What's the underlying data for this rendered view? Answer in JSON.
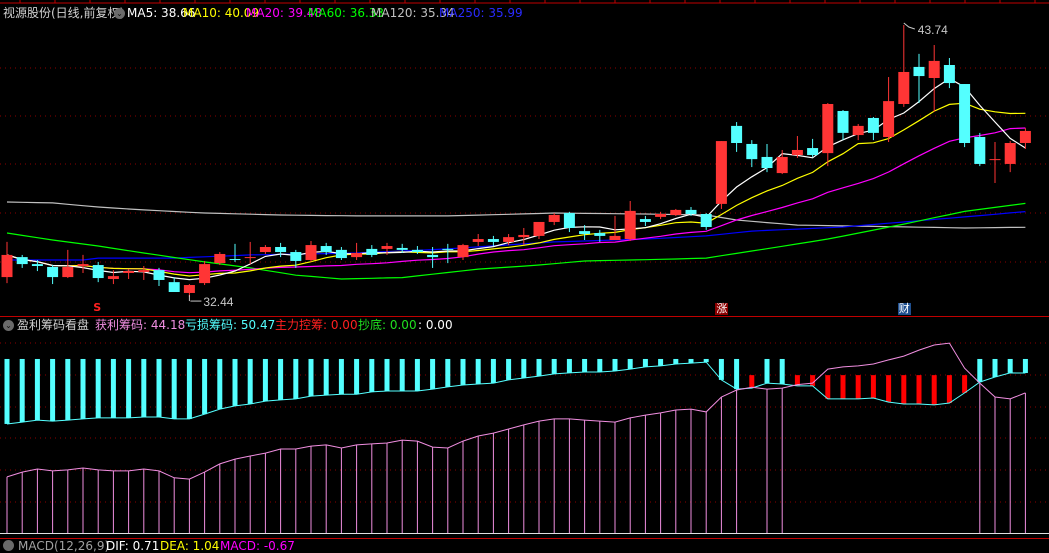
{
  "header": {
    "title": "视源股份(日线,前复权)",
    "ma5": "MA5: 38.66",
    "ma10": "MA10: 40.09",
    "ma20": "MA20: 39.48",
    "ma60": "MA60: 36.33",
    "ma120": "MA120: 35.34",
    "ma250": "MA250: 35.99"
  },
  "indicator_header": {
    "name": "盈利筹码看盘",
    "profit": "获利筹码: 44.18",
    "loss": "亏损筹码: 50.47",
    "main_control": "主力控筹: 0.00",
    "bottom_fish": "抄底: 0.00",
    "extra": ": 0.00"
  },
  "macd_header": {
    "name": "MACD(12,26,9)",
    "dif": "DIF: 0.71",
    "dea": "DEA: 1.04",
    "macd": "MACD: -0.67"
  },
  "colors": {
    "up": "#ff3535",
    "down": "#54ffff",
    "ma5": "#ffffff",
    "ma10": "#ffff00",
    "ma20": "#ff00ff",
    "ma60": "#00ff00",
    "ma120": "#c0c0c0",
    "ma250": "#0000ff",
    "profit": "#f08ee0",
    "red_bar": "#ff0000",
    "grid": "#8b0000"
  },
  "chart_data": [
    {
      "type": "candlestick",
      "title": "视源股份(日线,前复权)",
      "ohlc": [
        [
          33.27,
          34.73,
          33.02,
          34.19
        ],
        [
          34.1,
          34.19,
          33.65,
          33.81
        ],
        [
          33.81,
          33.98,
          33.52,
          33.73
        ],
        [
          33.69,
          33.77,
          32.98,
          33.27
        ],
        [
          33.27,
          34.4,
          33.23,
          33.69
        ],
        [
          33.73,
          34.19,
          33.44,
          33.81
        ],
        [
          33.77,
          33.9,
          33.06,
          33.23
        ],
        [
          33.19,
          33.56,
          32.98,
          33.31
        ],
        [
          33.44,
          33.6,
          33.19,
          33.52
        ],
        [
          33.48,
          33.73,
          33.15,
          33.56
        ],
        [
          33.56,
          33.65,
          32.9,
          33.15
        ],
        [
          33.06,
          33.27,
          32.65,
          32.65
        ],
        [
          32.61,
          32.98,
          32.44,
          32.94
        ],
        [
          33.02,
          33.94,
          32.94,
          33.81
        ],
        [
          33.85,
          34.31,
          33.77,
          34.23
        ],
        [
          34.02,
          34.65,
          33.9,
          33.98
        ],
        [
          34.06,
          34.73,
          33.81,
          34.1
        ],
        [
          34.31,
          34.6,
          34.23,
          34.52
        ],
        [
          34.52,
          34.69,
          34.1,
          34.31
        ],
        [
          34.31,
          34.4,
          33.65,
          33.94
        ],
        [
          33.98,
          34.77,
          33.9,
          34.6
        ],
        [
          34.56,
          34.69,
          34.19,
          34.31
        ],
        [
          34.4,
          34.52,
          33.98,
          34.06
        ],
        [
          34.1,
          34.69,
          33.98,
          34.27
        ],
        [
          34.44,
          34.6,
          34.1,
          34.19
        ],
        [
          34.44,
          34.69,
          34.19,
          34.56
        ],
        [
          34.48,
          34.65,
          34.27,
          34.4
        ],
        [
          34.4,
          34.56,
          34.23,
          34.31
        ],
        [
          34.19,
          34.52,
          33.65,
          34.1
        ],
        [
          34.44,
          34.65,
          33.85,
          34.4
        ],
        [
          34.1,
          34.65,
          33.98,
          34.6
        ],
        [
          34.73,
          35.06,
          34.56,
          34.85
        ],
        [
          34.85,
          34.98,
          34.56,
          34.73
        ],
        [
          34.73,
          35.06,
          34.6,
          34.93
        ],
        [
          34.93,
          35.31,
          34.6,
          35.02
        ],
        [
          34.98,
          35.56,
          34.85,
          35.56
        ],
        [
          35.56,
          35.93,
          35.43,
          35.85
        ],
        [
          35.93,
          35.98,
          35.14,
          35.31
        ],
        [
          35.18,
          35.43,
          34.81,
          35.06
        ],
        [
          35.1,
          35.23,
          34.73,
          34.98
        ],
        [
          34.81,
          35.81,
          34.81,
          34.98
        ],
        [
          34.85,
          36.43,
          34.77,
          36.02
        ],
        [
          35.68,
          35.81,
          35.39,
          35.56
        ],
        [
          35.77,
          35.98,
          35.68,
          35.89
        ],
        [
          35.85,
          36.1,
          35.81,
          36.06
        ],
        [
          36.06,
          36.18,
          35.81,
          35.89
        ],
        [
          35.89,
          35.93,
          35.23,
          35.35
        ],
        [
          36.31,
          38.92,
          36.1,
          38.92
        ],
        [
          39.55,
          39.71,
          38.47,
          38.84
        ],
        [
          38.8,
          38.96,
          37.84,
          38.17
        ],
        [
          38.26,
          38.8,
          37.63,
          37.8
        ],
        [
          37.59,
          38.55,
          37.55,
          38.26
        ],
        [
          38.34,
          39.13,
          38.22,
          38.55
        ],
        [
          38.63,
          39.01,
          38.26,
          38.34
        ],
        [
          38.42,
          40.5,
          37.88,
          40.46
        ],
        [
          40.17,
          40.21,
          38.96,
          39.26
        ],
        [
          39.17,
          39.63,
          38.96,
          39.55
        ],
        [
          39.88,
          39.92,
          38.96,
          39.26
        ],
        [
          39.09,
          41.58,
          38.88,
          40.58
        ],
        [
          40.46,
          43.74,
          40.34,
          41.79
        ],
        [
          42.0,
          42.54,
          40.5,
          41.62
        ],
        [
          41.54,
          42.91,
          40.13,
          42.25
        ],
        [
          42.08,
          42.37,
          41.12,
          41.33
        ],
        [
          41.29,
          41.29,
          38.67,
          38.84
        ],
        [
          39.09,
          39.26,
          37.88,
          37.97
        ],
        [
          38.13,
          38.88,
          37.18,
          38.17
        ],
        [
          37.97,
          38.92,
          37.63,
          38.84
        ],
        [
          38.84,
          39.46,
          38.59,
          39.34
        ]
      ],
      "moving_averages": {
        "ma5": {
          "period": 5
        },
        "ma10": {
          "period": 10
        },
        "ma20": {
          "period": 20
        },
        "ma60_anchors": [
          [
            0,
            35.1
          ],
          [
            3,
            34.81
          ],
          [
            6,
            34.56
          ],
          [
            9,
            34.27
          ],
          [
            13,
            33.9
          ],
          [
            16,
            33.65
          ],
          [
            19,
            33.35
          ],
          [
            22,
            33.19
          ],
          [
            26,
            33.25
          ],
          [
            31,
            33.6
          ],
          [
            35,
            33.77
          ],
          [
            38,
            33.94
          ],
          [
            44,
            34.02
          ],
          [
            46,
            34.06
          ],
          [
            50,
            34.45
          ],
          [
            54,
            34.85
          ],
          [
            59,
            35.47
          ],
          [
            63,
            36.0
          ],
          [
            67,
            36.33
          ]
        ],
        "ma120_anchors": [
          [
            0,
            36.39
          ],
          [
            3,
            36.35
          ],
          [
            6,
            36.18
          ],
          [
            9,
            36.06
          ],
          [
            13,
            35.93
          ],
          [
            18,
            35.85
          ],
          [
            23,
            35.81
          ],
          [
            29,
            35.81
          ],
          [
            36,
            35.93
          ],
          [
            42,
            35.89
          ],
          [
            46,
            35.85
          ],
          [
            48,
            35.64
          ],
          [
            52,
            35.43
          ],
          [
            63,
            35.31
          ],
          [
            67,
            35.34
          ]
        ],
        "ma250_anchors": [
          [
            0,
            33.98
          ],
          [
            5,
            33.98
          ],
          [
            6,
            34.06
          ],
          [
            11,
            34.06
          ],
          [
            16,
            34.19
          ],
          [
            23,
            34.27
          ],
          [
            29,
            34.44
          ],
          [
            36,
            34.73
          ],
          [
            42,
            34.85
          ],
          [
            46,
            34.98
          ],
          [
            49,
            35.18
          ],
          [
            55,
            35.35
          ],
          [
            59,
            35.56
          ],
          [
            63,
            35.77
          ],
          [
            67,
            35.99
          ]
        ]
      },
      "annotations": {
        "high": {
          "index": 59,
          "label": "43.74"
        },
        "low": {
          "index": 12,
          "label": "32.44"
        },
        "markers": [
          {
            "index": 6,
            "label": "S",
            "color": "#ff2020"
          },
          {
            "index": 47,
            "label": "涨",
            "color": "#8b0000"
          },
          {
            "index": 59,
            "label": "财",
            "color": "#1f4f8f"
          }
        ]
      },
      "ylim": [
        32.2,
        44.0
      ]
    },
    {
      "type": "bar",
      "title": "盈利筹码看盘",
      "profit": [
        17.7,
        19.2,
        20.2,
        19.6,
        19.9,
        20.5,
        19.9,
        19.6,
        19.6,
        20.2,
        19.6,
        17.4,
        17.0,
        19.2,
        21.8,
        23.3,
        24.3,
        25.2,
        26.5,
        26.5,
        27.4,
        27.8,
        26.8,
        27.8,
        28.1,
        28.4,
        29.3,
        29.0,
        27.1,
        26.8,
        29.0,
        30.6,
        31.5,
        32.8,
        34.1,
        35.3,
        36.0,
        36.0,
        35.6,
        35.3,
        35.0,
        36.3,
        37.2,
        37.9,
        38.8,
        39.1,
        38.2,
        42.9,
        45.1,
        46.0,
        45.4,
        45.7,
        46.8,
        47.3,
        51.7,
        52.4,
        52.7,
        53.3,
        54.6,
        55.8,
        57.7,
        59.3,
        59.9,
        52.0,
        47.3,
        42.9,
        42.3,
        44.18
      ],
      "loss": [
        34.4,
        35.0,
        35.6,
        35.3,
        35.6,
        36.0,
        36.3,
        36.3,
        36.3,
        36.6,
        36.6,
        36.0,
        36.0,
        37.5,
        39.1,
        40.1,
        40.7,
        41.6,
        42.0,
        42.3,
        43.2,
        43.5,
        43.8,
        43.8,
        44.5,
        44.8,
        44.8,
        44.8,
        45.4,
        46.1,
        46.7,
        47.0,
        47.3,
        48.3,
        48.9,
        49.5,
        50.2,
        50.5,
        50.8,
        50.8,
        51.1,
        51.7,
        52.4,
        52.7,
        53.3,
        53.6,
        53.9,
        48.3,
        45.4,
        45.7,
        47.3,
        47.0,
        46.4,
        46.4,
        42.3,
        42.3,
        42.3,
        42.6,
        41.3,
        40.7,
        40.7,
        40.4,
        41.0,
        44.2,
        47.6,
        49.2,
        50.5,
        50.47
      ],
      "cyan_bar_top": 54.9,
      "red_bar_top": 49.8,
      "ylim": [
        0,
        65
      ]
    }
  ]
}
